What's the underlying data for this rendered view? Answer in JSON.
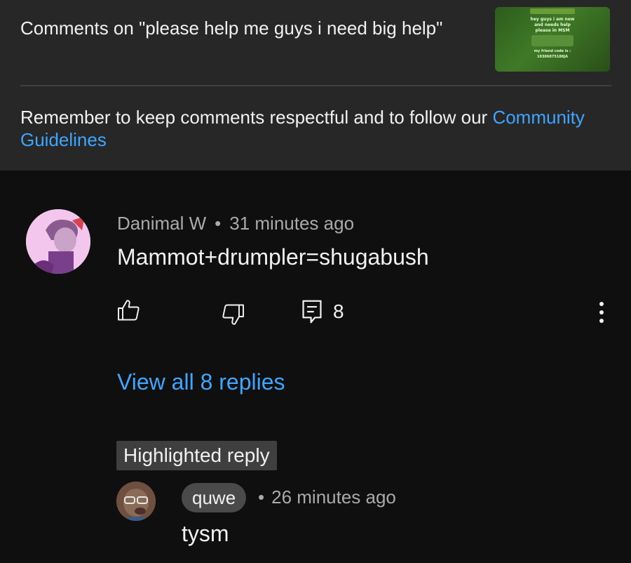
{
  "header": {
    "title": "Comments on \"please help me guys i need big help\"",
    "thumbnail": {
      "lines": [
        "hey guys i am new",
        "and needs help",
        "please in MSM",
        "my friend code is :",
        "10306875188JA"
      ],
      "bg_color": "#3f7a27"
    }
  },
  "notice": {
    "text": "Remember to keep comments respectful and to follow our",
    "link_label": "Community Guidelines"
  },
  "comment": {
    "author": "Danimal W",
    "separator": "•",
    "time": "31 minutes ago",
    "text": "Mammot+drumpler=shugabush",
    "icons": {
      "like": "thumbs-up-icon",
      "dislike": "thumbs-down-icon",
      "reply": "reply-icon",
      "more": "more-vert-icon"
    },
    "reply_count": "8",
    "view_replies_label": "View all 8 replies"
  },
  "highlighted": {
    "badge": "Highlighted reply",
    "author": "quwe",
    "separator": "•",
    "time": "26 minutes ago",
    "text": "tysm"
  },
  "colors": {
    "background": "#0f0f0f",
    "header_bg": "#272727",
    "link": "#3ea6ff",
    "secondary_text": "#aaaaaa"
  }
}
